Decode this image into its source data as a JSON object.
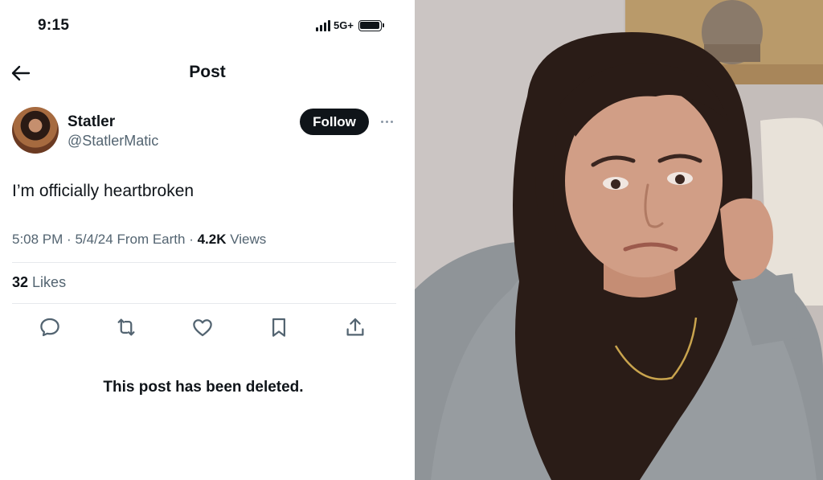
{
  "status_bar": {
    "time": "9:15",
    "network": "5G+"
  },
  "header": {
    "title": "Post"
  },
  "author": {
    "name": "Statler",
    "handle": "@StatlerMatic",
    "follow_label": "Follow"
  },
  "post": {
    "text": "I’m officially heartbroken",
    "time": "5:08 PM",
    "date": "5/4/24",
    "source": "From Earth",
    "views_count": "4.2K",
    "views_label": "Views",
    "likes_count": "32",
    "likes_label": "Likes"
  },
  "actions": {
    "icons": [
      "reply-icon",
      "repost-icon",
      "like-icon",
      "bookmark-icon",
      "share-icon"
    ]
  },
  "notice": {
    "deleted_text": "This post has been deleted."
  },
  "colors": {
    "text_primary": "#0f1419",
    "text_secondary": "#536471",
    "divider": "#e6e9ec",
    "follow_bg": "#0f1419"
  }
}
